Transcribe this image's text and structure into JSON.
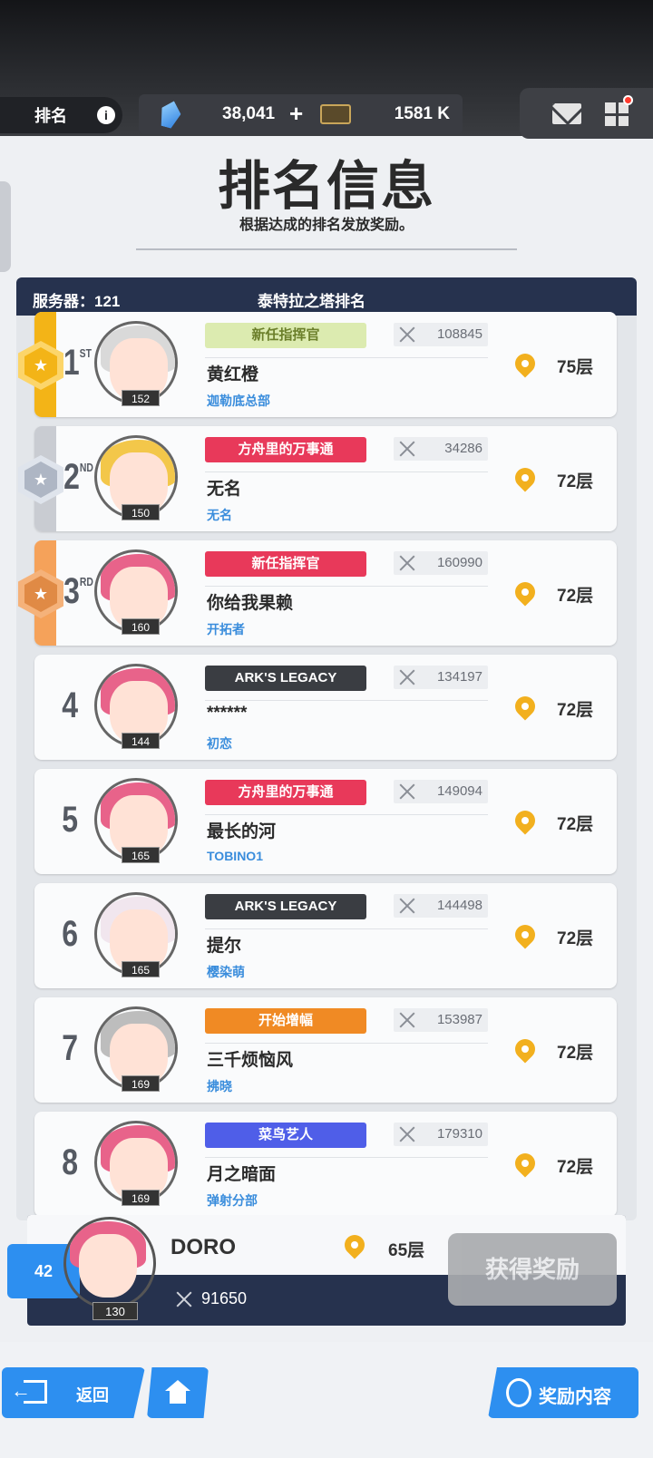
{
  "topbar": {
    "rank_label": "排名",
    "info_icon": "info-icon",
    "gems": "38,041",
    "plus": "+",
    "credits": "1581 K"
  },
  "header": {
    "title": "排名信息",
    "subtitle": "根据达成的排名发放奖励。"
  },
  "panel": {
    "server_label": "服务器：121",
    "tower_label": "泰特拉之塔排名"
  },
  "rows": [
    {
      "rank": "1",
      "suffix": "ST",
      "level": "152",
      "badge": "新任指挥官",
      "power": "108845",
      "name": "黄红橙",
      "guild": "迦勒底总部",
      "floor": "75层",
      "accent": "#f3b417",
      "badge_color": "#dcebb0",
      "badge_text_color": "#6b7f2a",
      "hair_color": "#d9d9d9"
    },
    {
      "rank": "2",
      "suffix": "ND",
      "level": "150",
      "badge": "方舟里的万事通",
      "power": "34286",
      "name": "无名",
      "guild": "无名",
      "floor": "72层",
      "accent": "#c9ccd2",
      "badge_color": "#e8395a",
      "badge_text_color": "#ffffff",
      "hair_color": "#f3c74a"
    },
    {
      "rank": "3",
      "suffix": "RD",
      "level": "160",
      "badge": "新任指挥官",
      "power": "160990",
      "name": "你给我果赖",
      "guild": "开拓者",
      "floor": "72层",
      "accent": "#f5a25a",
      "badge_color": "#e8395a",
      "badge_text_color": "#ffffff",
      "hair_color": "#e8638a"
    },
    {
      "rank": "4",
      "suffix": "",
      "level": "144",
      "badge": "ARK'S LEGACY",
      "power": "134197",
      "name": "******",
      "guild": "初恋",
      "floor": "72层",
      "accent": "",
      "badge_color": "#3a3d42",
      "badge_text_color": "#ffffff",
      "hair_color": "#e8638a"
    },
    {
      "rank": "5",
      "suffix": "",
      "level": "165",
      "badge": "方舟里的万事通",
      "power": "149094",
      "name": "最长的河",
      "guild": "TOBINO1",
      "floor": "72层",
      "accent": "",
      "badge_color": "#e8395a",
      "badge_text_color": "#ffffff",
      "hair_color": "#e8638a"
    },
    {
      "rank": "6",
      "suffix": "",
      "level": "165",
      "badge": "ARK'S LEGACY",
      "power": "144498",
      "name": "提尔",
      "guild": "樱染萌",
      "floor": "72层",
      "accent": "",
      "badge_color": "#3a3d42",
      "badge_text_color": "#ffffff",
      "hair_color": "#f1e6ee"
    },
    {
      "rank": "7",
      "suffix": "",
      "level": "169",
      "badge": "开始增幅",
      "power": "153987",
      "name": "三千烦恼风",
      "guild": "拂晓",
      "floor": "72层",
      "accent": "",
      "badge_color": "#f08a24",
      "badge_text_color": "#ffffff",
      "hair_color": "#bdbdbd"
    },
    {
      "rank": "8",
      "suffix": "",
      "level": "169",
      "badge": "菜鸟艺人",
      "power": "179310",
      "name": "月之暗面",
      "guild": "弹射分部",
      "floor": "72层",
      "accent": "",
      "badge_color": "#4f5ee8",
      "badge_text_color": "#ffffff",
      "hair_color": "#e8638a"
    }
  ],
  "me": {
    "rank": "42",
    "level": "130",
    "name": "DORO",
    "floor": "65层",
    "power": "91650",
    "claim_label": "获得奖励"
  },
  "footer": {
    "back_label": "返回",
    "reward_label": "奖励内容"
  }
}
